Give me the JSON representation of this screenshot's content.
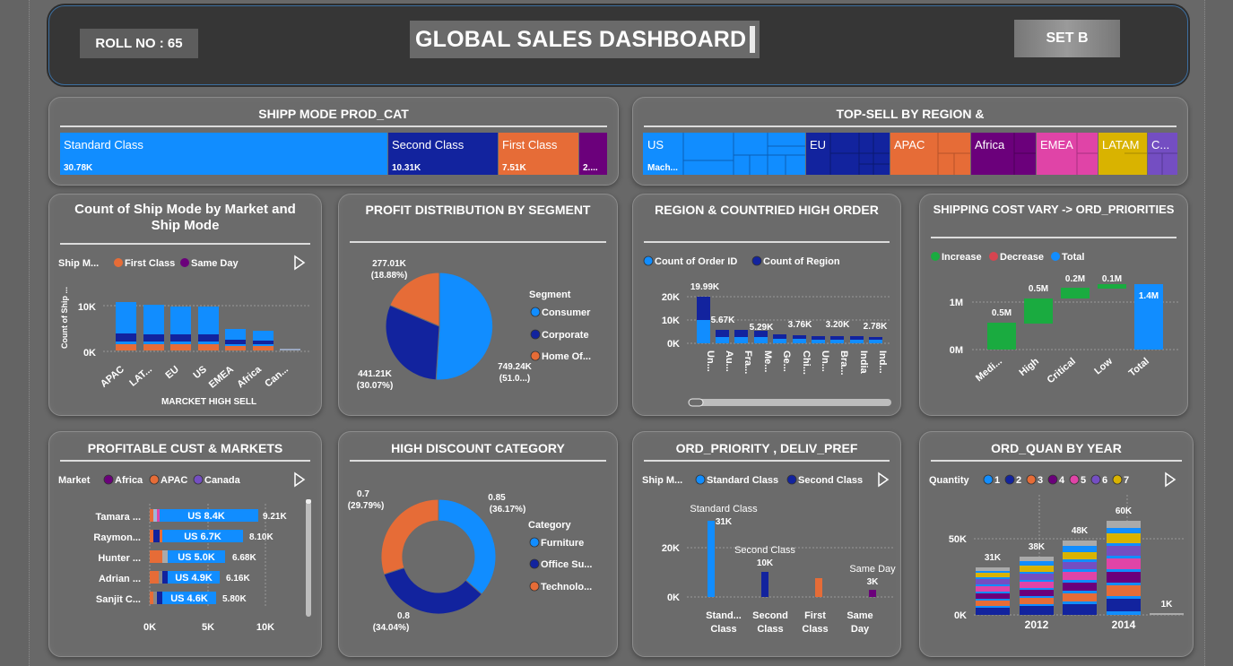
{
  "header": {
    "roll_label": "ROLL NO : 65",
    "title": "GLOBAL SALES DASHBOARD",
    "set_label": "SET B"
  },
  "cards": {
    "shipp_mode": {
      "title": "SHIPP MODE PROD_CAT",
      "items": [
        {
          "label": "Standard Class",
          "value": "30.78K",
          "color": "#118DFF"
        },
        {
          "label": "Second Class",
          "value": "10.31K",
          "color": "#12239E"
        },
        {
          "label": "First Class",
          "value": "7.51K",
          "color": "#E66C37"
        },
        {
          "label": "",
          "value": "2....",
          "color": "#6B007B"
        }
      ]
    },
    "top_sell": {
      "title": "TOP-SELL BY REGION &",
      "items": [
        {
          "label": "US",
          "sub": "Mach...",
          "color": "#118DFF"
        },
        {
          "label": "EU",
          "sub": "",
          "color": "#12239E"
        },
        {
          "label": "APAC",
          "sub": "",
          "color": "#E66C37"
        },
        {
          "label": "Africa",
          "sub": "",
          "color": "#6B007B"
        },
        {
          "label": "EMEA",
          "sub": "",
          "color": "#E044A7"
        },
        {
          "label": "LATAM",
          "sub": "",
          "color": "#D9B300"
        },
        {
          "label": "C...",
          "sub": "",
          "color": "#744EC2"
        }
      ]
    },
    "count_ship": {
      "title": "Count of Ship Mode by Market and Ship Mode",
      "legend_title": "Ship M...",
      "legend": [
        "First Class",
        "Same Day"
      ],
      "ylabel": "Count of Ship ...",
      "xlabel": "MARCKET HIGH SELL",
      "yticks": [
        "10K",
        "0K"
      ],
      "categories": [
        "APAC",
        "LAT...",
        "EU",
        "US",
        "EMEA",
        "Africa",
        "Can..."
      ]
    },
    "profit_dist": {
      "title": "PROFIT DISTRIBUTION BY SEGMENT",
      "legend_title": "Segment",
      "legend": [
        "Consumer",
        "Corporate",
        "Home Of..."
      ],
      "labels": [
        {
          "l1": "277.01K",
          "l2": "(18.88%)"
        },
        {
          "l1": "441.21K",
          "l2": "(30.07%)"
        },
        {
          "l1": "749.24K",
          "l2": "(51.0...)"
        }
      ]
    },
    "region_high": {
      "title": "REGION & COUNTRIED HIGH ORDER",
      "legend": [
        "Count of Order ID",
        "Count of Region"
      ],
      "yticks": [
        "20K",
        "10K",
        "0K"
      ],
      "categories": [
        "Un...",
        "Au...",
        "Fra...",
        "Me...",
        "Ge...",
        "Chi...",
        "Un...",
        "Bra...",
        "India",
        "Ind..."
      ],
      "data_labels": [
        "19.99K",
        "5.67K",
        "5.29K",
        "3.76K",
        "3.20K",
        "2.78K"
      ]
    },
    "ship_cost": {
      "title": "SHIPPING COST VARY -> ORD_PRIORITIES",
      "legend": [
        "Increase",
        "Decrease",
        "Total"
      ],
      "yticks": [
        "1M",
        "0M"
      ],
      "categories": [
        "Medi...",
        "High",
        "Critical",
        "Low",
        "Total"
      ],
      "data_labels": [
        "0.5M",
        "0.5M",
        "0.2M",
        "0.1M",
        "1.4M"
      ]
    },
    "profitable_cust": {
      "title": "PROFITABLE CUST & MARKETS",
      "legend_title": "Market",
      "legend": [
        "Africa",
        "APAC",
        "Canada"
      ],
      "rows": [
        {
          "name": "Tamara ...",
          "inner": "US 8.4K",
          "total": "9.21K"
        },
        {
          "name": "Raymon...",
          "inner": "US 6.7K",
          "total": "8.10K"
        },
        {
          "name": "Hunter ...",
          "inner": "US 5.0K",
          "total": "6.68K"
        },
        {
          "name": "Adrian ...",
          "inner": "US 4.9K",
          "total": "6.16K"
        },
        {
          "name": "Sanjit C...",
          "inner": "US 4.6K",
          "total": "5.80K"
        }
      ],
      "xticks": [
        "0K",
        "5K",
        "10K"
      ]
    },
    "high_discount": {
      "title": "HIGH DISCOUNT CATEGORY",
      "legend_title": "Category",
      "legend": [
        "Furniture",
        "Office Su...",
        "Technolo..."
      ],
      "labels": [
        {
          "l1": "0.7",
          "l2": "(29.79%)"
        },
        {
          "l1": "0.85",
          "l2": "(36.17%)"
        },
        {
          "l1": "0.8",
          "l2": "(34.04%)"
        }
      ]
    },
    "ord_priority": {
      "title": "ORD_PRIORITY , DELIV_PREF",
      "legend_title": "Ship M...",
      "legend": [
        "Standard Class",
        "Second Class"
      ],
      "yticks": [
        "20K",
        "0K"
      ],
      "categories": [
        "Stand... Class",
        "Second Class",
        "First Class",
        "Same Day"
      ],
      "bar_labels": [
        {
          "name": "Standard Class",
          "value": "31K"
        },
        {
          "name": "Second Class",
          "value": "10K"
        },
        {
          "name": "Same Day",
          "value": "3K"
        }
      ]
    },
    "ord_quan": {
      "title": "ORD_QUAN BY YEAR",
      "legend_title": "Quantity",
      "legend": [
        "1",
        "2",
        "3",
        "4",
        "5",
        "6",
        "7"
      ],
      "yticks": [
        "50K",
        "0K"
      ],
      "xticks": [
        "2012",
        "2014"
      ],
      "data_labels": [
        "31K",
        "38K",
        "48K",
        "60K",
        "1K"
      ]
    }
  }
}
